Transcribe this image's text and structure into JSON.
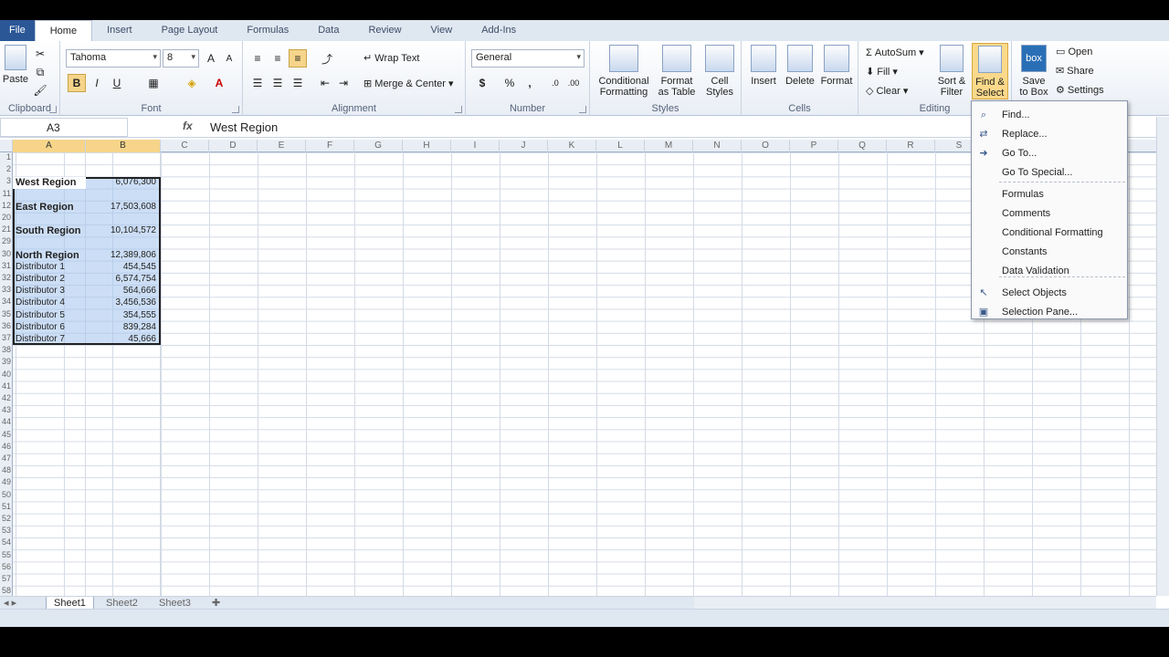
{
  "tabs": [
    "File",
    "Home",
    "Insert",
    "Page Layout",
    "Formulas",
    "Data",
    "Review",
    "View",
    "Add-Ins"
  ],
  "ribbon": {
    "clipboard": {
      "label": "Clipboard",
      "paste": "Paste"
    },
    "font": {
      "label": "Font",
      "name": "Tahoma",
      "size": "8",
      "bold": "B",
      "italic": "I",
      "underline": "U"
    },
    "alignment": {
      "label": "Alignment",
      "wrap_text": "Wrap Text",
      "merge_center": "Merge & Center"
    },
    "number": {
      "label": "Number",
      "format": "General",
      "currency": "$",
      "percent": "%",
      "comma": ","
    },
    "styles": {
      "label": "Styles",
      "conditional": [
        "Conditional",
        "Formatting"
      ],
      "format_table": [
        "Format",
        "as Table"
      ],
      "cell_styles": [
        "Cell",
        "Styles"
      ]
    },
    "cells": {
      "label": "Cells",
      "insert": "Insert",
      "delete": "Delete",
      "format": "Format"
    },
    "editing": {
      "label": "Editing",
      "autosum": "AutoSum",
      "fill": "Fill",
      "clear": "Clear",
      "sort": [
        "Sort &",
        "Filter"
      ],
      "find": [
        "Find &",
        "Select"
      ]
    },
    "box": {
      "save": [
        "Save",
        "to Box"
      ],
      "open": "Open",
      "share": "Share",
      "settings": "Settings",
      "logo": "box"
    }
  },
  "formula_bar": {
    "name_box": "A3",
    "fx": "fx",
    "value": "West Region"
  },
  "columns": [
    "A",
    "B",
    "C",
    "D",
    "E",
    "F",
    "G",
    "H",
    "I",
    "J",
    "K",
    "L",
    "M",
    "N",
    "O",
    "P",
    "Q",
    "R",
    "S"
  ],
  "rows": [
    {
      "num": "1",
      "a": "",
      "b": "",
      "style": "blank"
    },
    {
      "num": "2",
      "a": "",
      "b": "",
      "style": "blank"
    },
    {
      "num": "3",
      "a": "West Region",
      "b": "6,076,300",
      "style": "bold"
    },
    {
      "num": "11",
      "a": "",
      "b": "",
      "style": "blank"
    },
    {
      "num": "12",
      "a": "East Region",
      "b": "17,503,608",
      "style": "bold"
    },
    {
      "num": "20",
      "a": "",
      "b": "",
      "style": "blank"
    },
    {
      "num": "21",
      "a": "South Region",
      "b": "10,104,572",
      "style": "bold"
    },
    {
      "num": "29",
      "a": "",
      "b": "",
      "style": "blank"
    },
    {
      "num": "30",
      "a": "North Region",
      "b": "12,389,806",
      "style": "bold"
    },
    {
      "num": "31",
      "a": "Distributor 1",
      "b": "454,545",
      "style": "normal"
    },
    {
      "num": "32",
      "a": "Distributor 2",
      "b": "6,574,754",
      "style": "normal"
    },
    {
      "num": "33",
      "a": "Distributor 3",
      "b": "564,666",
      "style": "normal"
    },
    {
      "num": "34",
      "a": "Distributor 4",
      "b": "3,456,536",
      "style": "normal"
    },
    {
      "num": "35",
      "a": "Distributor 5",
      "b": "354,555",
      "style": "normal"
    },
    {
      "num": "36",
      "a": "Distributor 6",
      "b": "839,284",
      "style": "normal"
    },
    {
      "num": "37",
      "a": "Distributor 7",
      "b": "45,666",
      "style": "normal"
    }
  ],
  "sheets": [
    "Sheet1",
    "Sheet2",
    "Sheet3"
  ],
  "menu": [
    {
      "label": "Find...",
      "icon": "binoculars-icon"
    },
    {
      "label": "Replace...",
      "icon": "replace-icon"
    },
    {
      "label": "Go To...",
      "icon": "arrow-right-icon"
    },
    {
      "label": "Go To Special...",
      "icon": ""
    },
    {
      "label": "Formulas",
      "icon": ""
    },
    {
      "label": "Comments",
      "icon": ""
    },
    {
      "label": "Conditional Formatting",
      "icon": ""
    },
    {
      "label": "Constants",
      "icon": ""
    },
    {
      "label": "Data Validation",
      "icon": ""
    },
    {
      "label": "Select Objects",
      "icon": "pointer-icon"
    },
    {
      "label": "Selection Pane...",
      "icon": "selection-pane-icon"
    }
  ],
  "colors": {
    "accent": "#2b5797",
    "selection": "#a3c3ec",
    "highlight": "#f6d58a"
  }
}
